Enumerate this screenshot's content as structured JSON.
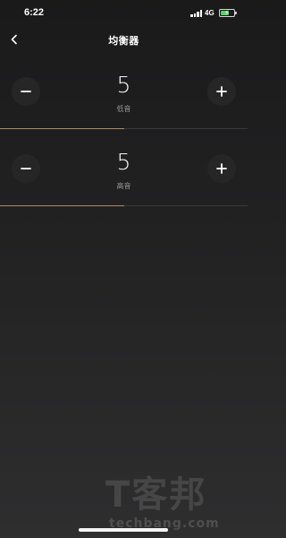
{
  "status_bar": {
    "time": "6:22",
    "network": "4G",
    "battery_charging": true
  },
  "header": {
    "title": "均衡器",
    "back_icon": "chevron-left-icon"
  },
  "equalizer": [
    {
      "value": "5",
      "label": "低音",
      "level_fraction": 0.5
    },
    {
      "value": "5",
      "label": "高音",
      "level_fraction": 0.5
    }
  ],
  "watermark": {
    "logo_text": "T客邦",
    "url": "techbang.com"
  },
  "colors": {
    "accent": "#b58a55",
    "button_bg": "#262627",
    "battery": "#4cd964"
  }
}
